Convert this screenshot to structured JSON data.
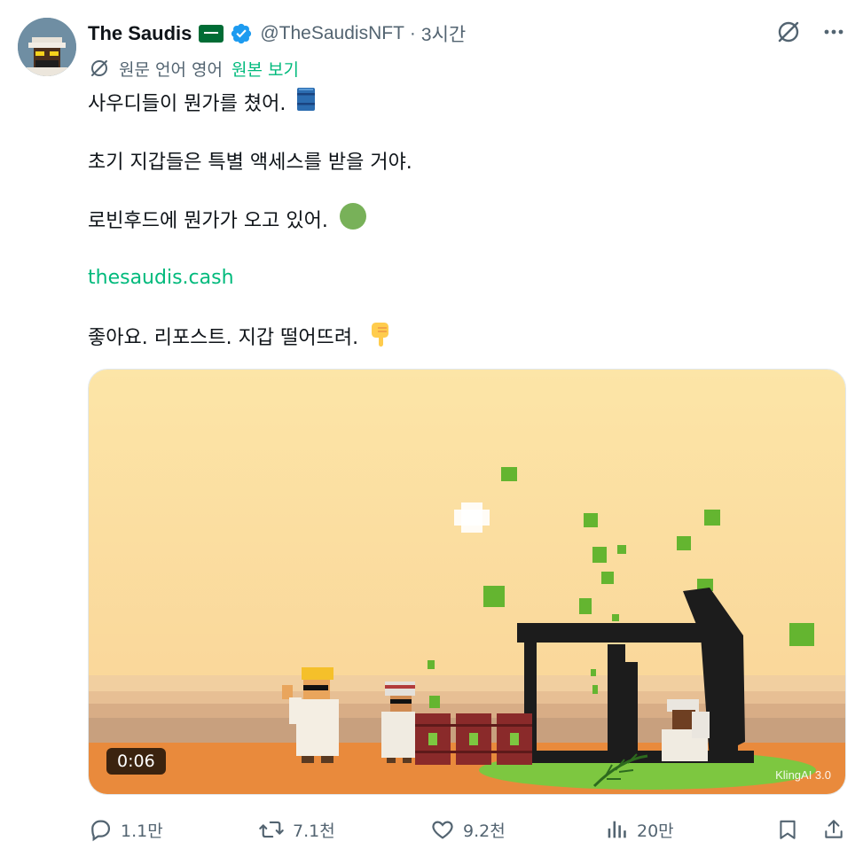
{
  "post": {
    "author_name": "The Saudis",
    "handle": "@TheSaudisNFT",
    "separator": "·",
    "time": "3시간",
    "translate_note": "원문 언어 영어",
    "translate_link": "원본 보기",
    "lines": [
      "사우디들이 뭔가를 쳤어.",
      "초기 지갑들은 특별 액세스를 받을 거야.",
      "로빈후드에 뭔가가 오고 있어.",
      "thesaudis.cash",
      "좋아요. 리포스트. 지갑 떨어뜨려."
    ],
    "emojis": [
      "oil-barrel",
      "green-circle",
      "pointing-down"
    ]
  },
  "media": {
    "duration": "0:06",
    "watermark": "KlingAI 3.0"
  },
  "actions": {
    "replies": "1.1만",
    "reposts": "7.1천",
    "likes": "9.2천",
    "views": "20만"
  },
  "colors": {
    "accent": "#00ba7c",
    "muted": "#536471",
    "verified": "#1d9bf0",
    "flag": "#006c35",
    "oil_green": "#7dc740"
  },
  "icons": [
    "verified-badge-icon",
    "grok-icon",
    "more-icon",
    "translate-icon",
    "reply-icon",
    "repost-icon",
    "like-icon",
    "views-icon",
    "bookmark-icon",
    "share-icon"
  ]
}
